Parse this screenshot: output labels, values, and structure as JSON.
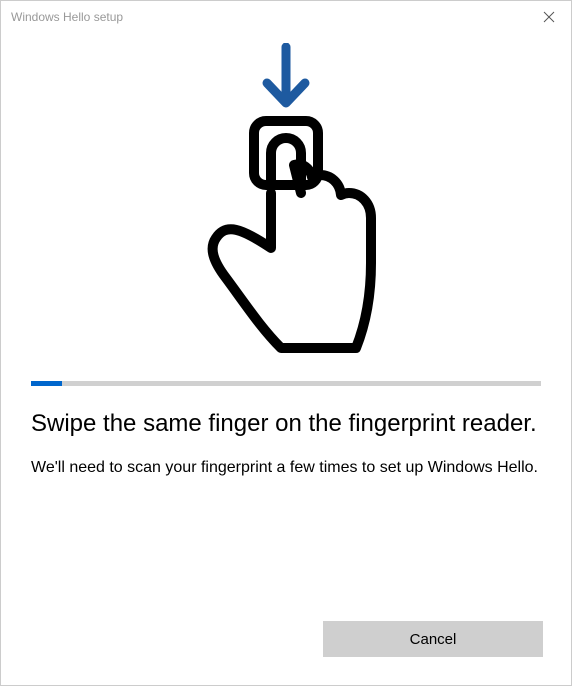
{
  "titlebar": {
    "title": "Windows Hello setup"
  },
  "progress": {
    "percent": 6
  },
  "main": {
    "heading": "Swipe the same finger on the fingerprint reader.",
    "body": "We'll need to scan your fingerprint a few times to set up Windows Hello."
  },
  "footer": {
    "cancel_label": "Cancel"
  },
  "colors": {
    "accent": "#0066cc"
  }
}
